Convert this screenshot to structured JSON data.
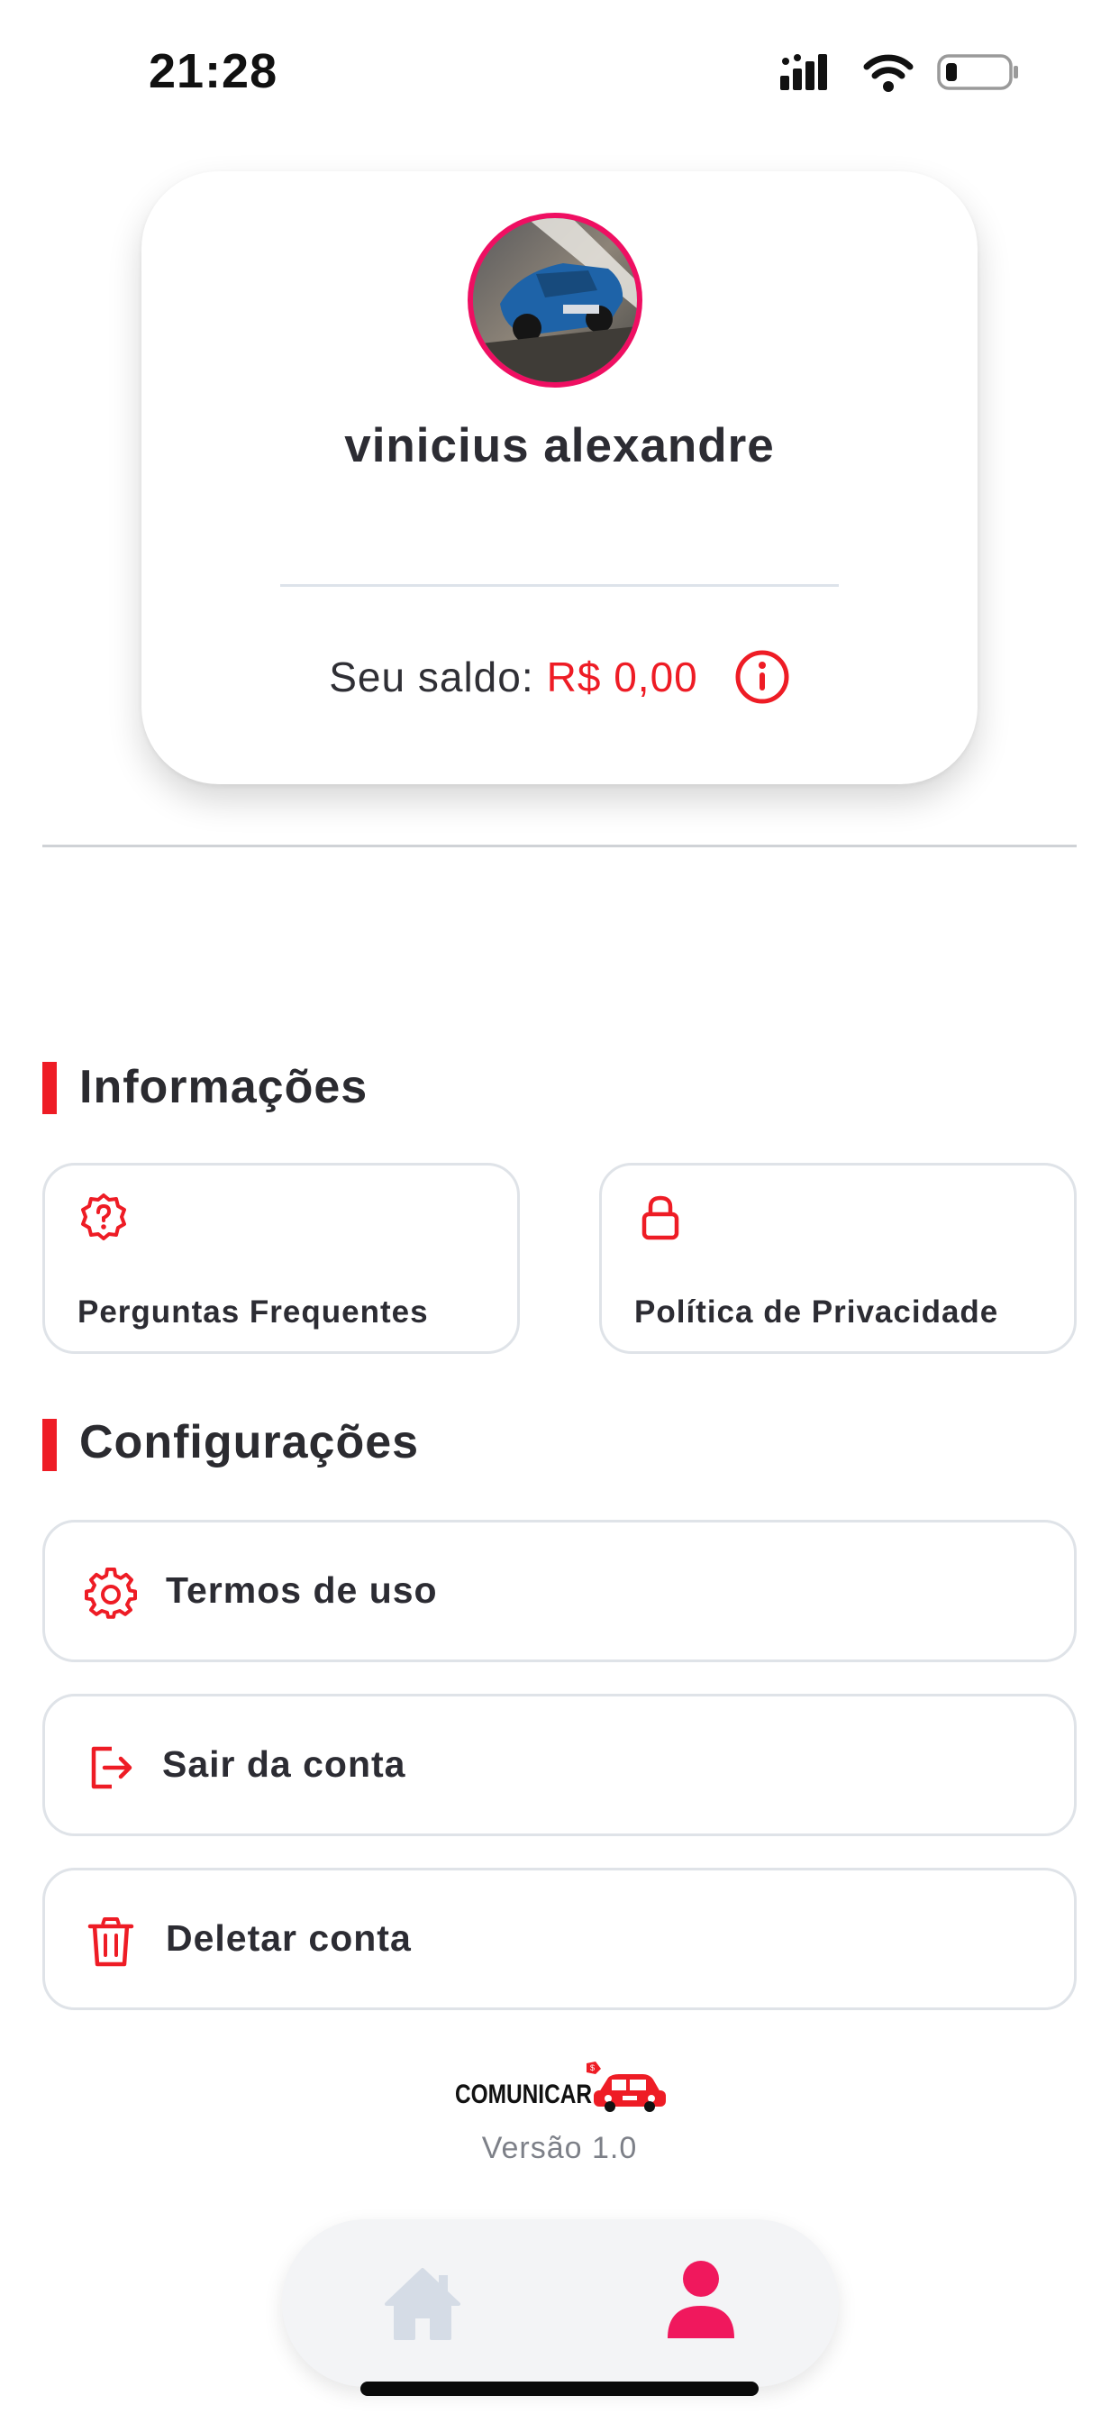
{
  "status_bar": {
    "time": "21:28"
  },
  "profile": {
    "name": "vinicius alexandre",
    "balance_label": "Seu saldo:",
    "balance_value": "R$ 0,00"
  },
  "sections": {
    "info": {
      "title": "Informações",
      "tiles": [
        {
          "label": "Perguntas Frequentes",
          "icon": "question-badge-icon"
        },
        {
          "label": "Política de Privacidade",
          "icon": "lock-icon"
        }
      ]
    },
    "settings": {
      "title": "Configurações",
      "rows": [
        {
          "label": "Termos de uso",
          "icon": "gear-icon"
        },
        {
          "label": "Sair da conta",
          "icon": "logout-icon"
        },
        {
          "label": "Deletar conta",
          "icon": "trash-icon"
        }
      ]
    }
  },
  "footer": {
    "logo_text": "COMUNICAR",
    "version": "Versão 1.0"
  },
  "nav": {
    "items": [
      {
        "icon": "home-icon",
        "active": false
      },
      {
        "icon": "user-icon",
        "active": true
      }
    ]
  },
  "colors": {
    "accent": "#ee1c25",
    "avatar_ring": "#ef0f62",
    "nav_active": "#f0185d",
    "nav_inactive": "#d5dce6"
  }
}
